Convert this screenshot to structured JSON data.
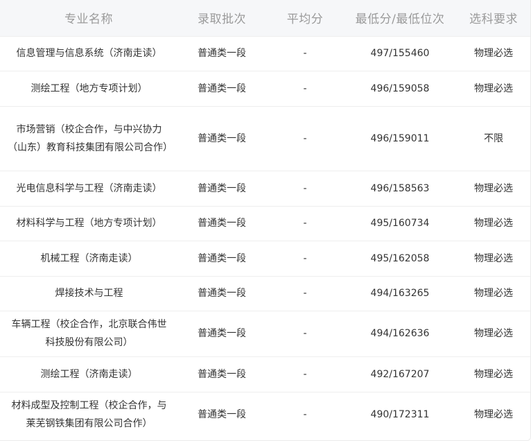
{
  "headers": [
    "专业名称",
    "录取批次",
    "平均分",
    "最低分/最低位次",
    "选科要求"
  ],
  "rows": [
    {
      "major": "信息管理与信息系统（济南走读）",
      "batch": "普通类一段",
      "avg": "-",
      "min": "497/155460",
      "req": "物理必选"
    },
    {
      "major": "测绘工程（地方专项计划）",
      "batch": "普通类一段",
      "avg": "-",
      "min": "496/159058",
      "req": "物理必选"
    },
    {
      "major": "市场营销（校企合作，与中兴协力（山东）教育科技集团有限公司合作）",
      "batch": "普通类一段",
      "avg": "-",
      "min": "496/159011",
      "req": "不限"
    },
    {
      "major": "光电信息科学与工程（济南走读）",
      "batch": "普通类一段",
      "avg": "-",
      "min": "496/158563",
      "req": "物理必选"
    },
    {
      "major": "材料科学与工程（地方专项计划）",
      "batch": "普通类一段",
      "avg": "-",
      "min": "495/160734",
      "req": "物理必选"
    },
    {
      "major": "机械工程（济南走读）",
      "batch": "普通类一段",
      "avg": "-",
      "min": "495/162058",
      "req": "物理必选"
    },
    {
      "major": "焊接技术与工程",
      "batch": "普通类一段",
      "avg": "-",
      "min": "494/163265",
      "req": "物理必选"
    },
    {
      "major": "车辆工程（校企合作，北京联合伟世科技股份有限公司）",
      "batch": "普通类一段",
      "avg": "-",
      "min": "494/162636",
      "req": "物理必选"
    },
    {
      "major": "测绘工程（济南走读）",
      "batch": "普通类一段",
      "avg": "-",
      "min": "492/167207",
      "req": "物理必选"
    },
    {
      "major": "材料成型及控制工程（校企合作，与莱芜钢铁集团有限公司合作）",
      "batch": "普通类一段",
      "avg": "-",
      "min": "490/172311",
      "req": "物理必选"
    }
  ]
}
